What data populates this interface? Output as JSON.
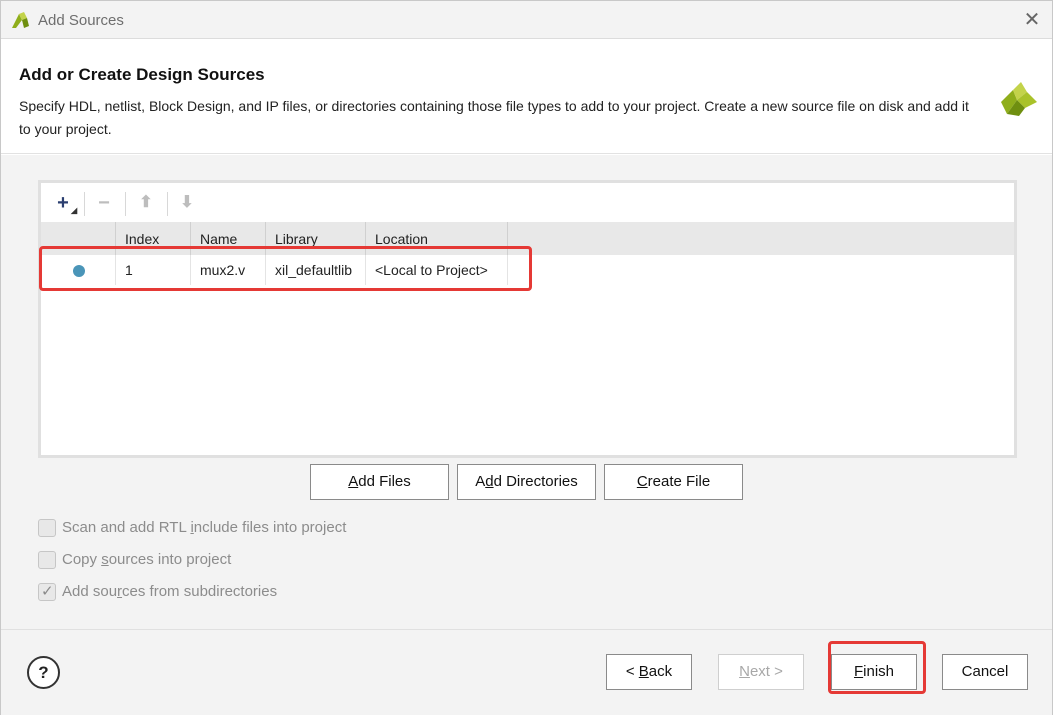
{
  "window": {
    "title": "Add Sources"
  },
  "header": {
    "title": "Add or Create Design Sources",
    "description": "Specify HDL, netlist, Block Design, and IP files, or directories containing those file types to add to your project. Create a new source file on disk and add it to your project."
  },
  "toolbar": {
    "add_icon": "plus-icon",
    "remove_icon": "minus-icon",
    "up_icon": "arrow-up-icon",
    "down_icon": "arrow-down-icon"
  },
  "table": {
    "columns": [
      "",
      "Index",
      "Name",
      "Library",
      "Location"
    ],
    "rows": [
      {
        "index": "1",
        "name": "mux2.v",
        "library": "xil_defaultlib",
        "location": "<Local to Project>"
      }
    ]
  },
  "actions": {
    "add_files": {
      "pre": "",
      "key": "A",
      "post": "dd Files"
    },
    "add_directories": {
      "pre": "A",
      "key": "d",
      "post": "d Directories"
    },
    "create_file": {
      "pre": "",
      "key": "C",
      "post": "reate File"
    }
  },
  "options": [
    {
      "pre": "Scan and add RTL ",
      "key": "i",
      "post": "nclude files into project",
      "checked": false
    },
    {
      "pre": "Copy ",
      "key": "s",
      "post": "ources into project",
      "checked": false
    },
    {
      "pre": "Add sou",
      "key": "r",
      "post": "ces from subdirectories",
      "checked": true
    }
  ],
  "footer": {
    "help": "?",
    "back": {
      "pre": "< ",
      "key": "B",
      "post": "ack"
    },
    "next": {
      "pre": "",
      "key": "N",
      "post": "ext >"
    },
    "finish": {
      "pre": "",
      "key": "F",
      "post": "inish"
    },
    "cancel": "Cancel"
  },
  "colors": {
    "accent_logo": "#8fae1b",
    "status_dot": "#4a95b8",
    "highlight": "#e53935"
  }
}
